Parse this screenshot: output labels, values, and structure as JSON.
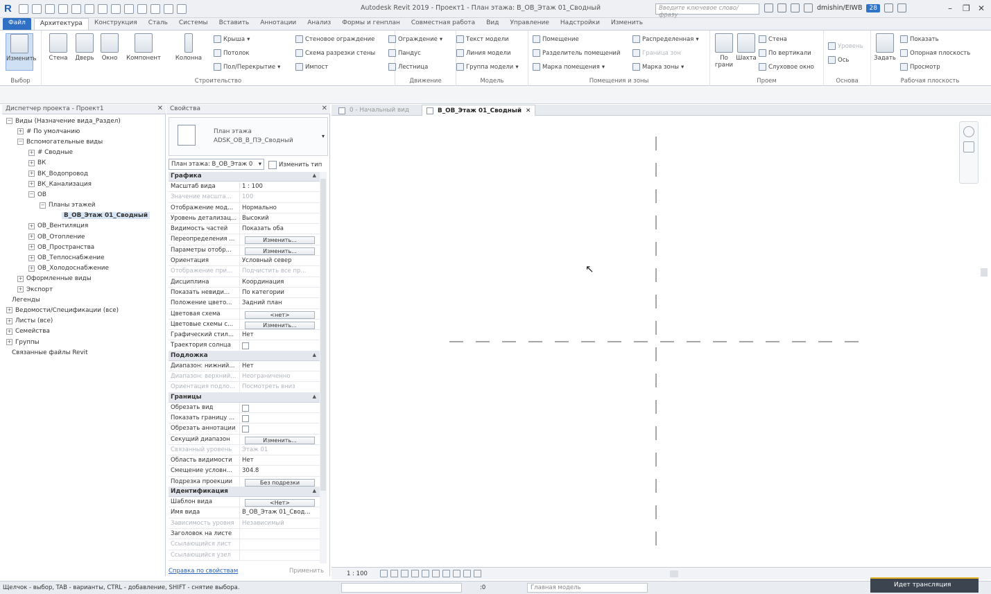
{
  "app": {
    "window_title": "Autodesk Revit 2019 - Проект1 - План этажа: В_ОВ_Этаж 01_Сводный",
    "search_placeholder": "Введите ключевое слово/фразу",
    "user": "dmishin/EIWB",
    "badge": "28",
    "logo": "R"
  },
  "ribbon_tabs": [
    "Файл",
    "Архитектура",
    "Конструкция",
    "Сталь",
    "Системы",
    "Вставить",
    "Аннотации",
    "Анализ",
    "Формы и генплан",
    "Совместная работа",
    "Вид",
    "Управление",
    "Надстройки",
    "Изменить"
  ],
  "ribbon": {
    "groups": [
      "Выбор",
      "Строительство",
      "Движение",
      "Модель",
      "Помещения и зоны",
      "Проем",
      "Основа",
      "Рабочая плоскость"
    ],
    "big_buttons": [
      "Изменить",
      "Стена",
      "Дверь",
      "Окно",
      "Компонент",
      "Колонна",
      "По грани",
      "Шахта",
      "Задать"
    ],
    "small_buttons": [
      "Крыша",
      "Потолок",
      "Пол/Перекрытие",
      "Стеновое ограждение",
      "Схема разрезки стены",
      "Импост",
      "Ограждение",
      "Пандус",
      "Лестница",
      "Текст модели",
      "Линия модели",
      "Группа модели",
      "Помещение",
      "Разделитель помещений",
      "Марка помещения",
      "Распределенная",
      "Граница зон",
      "Марка зоны",
      "Стена",
      "По вертикали",
      "Слуховое окно",
      "Уровень",
      "Ось",
      "Показать",
      "Опорная плоскость",
      "Просмотр"
    ]
  },
  "project_browser": {
    "title": "Диспетчер проекта - Проект1",
    "items": [
      {
        "label": "Виды (Назначение вида_Раздел)",
        "toggle": "⊟"
      },
      {
        "label": "# По умолчанию",
        "toggle": "⊞"
      },
      {
        "label": "Вспомогательные виды",
        "toggle": "⊟"
      },
      {
        "label": "# Сводные",
        "toggle": "⊞"
      },
      {
        "label": "ВК",
        "toggle": "⊞"
      },
      {
        "label": "ВК_Водопровод",
        "toggle": "⊞"
      },
      {
        "label": "ВК_Канализация",
        "toggle": "⊞"
      },
      {
        "label": "ОВ",
        "toggle": "⊟"
      },
      {
        "label": "Планы этажей",
        "toggle": "⊟"
      },
      {
        "label": "В_ОВ_Этаж 01_Сводный",
        "toggle": ""
      },
      {
        "label": "ОВ_Вентиляция",
        "toggle": "⊞"
      },
      {
        "label": "ОВ_Отопление",
        "toggle": "⊞"
      },
      {
        "label": "ОВ_Пространства",
        "toggle": "⊞"
      },
      {
        "label": "ОВ_Теплоснабжение",
        "toggle": "⊞"
      },
      {
        "label": "ОВ_Холодоснабжение",
        "toggle": "⊞"
      },
      {
        "label": "Оформленные виды",
        "toggle": "⊞"
      },
      {
        "label": "Экспорт",
        "toggle": "⊞"
      },
      {
        "label": "Легенды",
        "toggle": ""
      },
      {
        "label": "Ведомости/Спецификации (все)",
        "toggle": "⊞"
      },
      {
        "label": "Листы (все)",
        "toggle": "⊞"
      },
      {
        "label": "Семейства",
        "toggle": "⊞"
      },
      {
        "label": "Группы",
        "toggle": "⊞"
      },
      {
        "label": "Связанные файлы Revit",
        "toggle": ""
      }
    ]
  },
  "properties": {
    "title": "Свойства",
    "type_line1": "План этажа",
    "type_line2": "ADSK_ОВ_В_ПЭ_Сводный",
    "instance_selector": "План этажа: В_ОВ_Этаж 0",
    "edit_type": "Изменить тип",
    "sections": [
      {
        "name": "Графика",
        "rows": [
          [
            "Масштаб вида",
            "1 : 100",
            "",
            false
          ],
          [
            "Значение масшта...",
            "100",
            "",
            true
          ],
          [
            "Отображение мод...",
            "Нормально",
            "",
            false
          ],
          [
            "Уровень детализац...",
            "Высокий",
            "",
            false
          ],
          [
            "Видимость частей",
            "Показать оба",
            "",
            false
          ],
          [
            "Переопределения ...",
            "Изменить...",
            "btn",
            false
          ],
          [
            "Параметры отобр...",
            "Изменить...",
            "btn",
            false
          ],
          [
            "Ориентация",
            "Условный север",
            "",
            false
          ],
          [
            "Отображение при...",
            "Подчистить все пр...",
            "",
            true
          ],
          [
            "Дисциплина",
            "Координация",
            "",
            false
          ],
          [
            "Показать невиди...",
            "По категории",
            "",
            false
          ],
          [
            "Положение цвето...",
            "Задний план",
            "",
            false
          ],
          [
            "Цветовая схема",
            "<нет>",
            "btn",
            false
          ],
          [
            "Цветовые схемы с...",
            "Изменить...",
            "btn",
            false
          ],
          [
            "Графический стил...",
            "Нет",
            "",
            false
          ],
          [
            "Траектория солнца",
            "",
            "chk",
            false
          ]
        ]
      },
      {
        "name": "Подложка",
        "rows": [
          [
            "Диапазон: нижний...",
            "Нет",
            "",
            false
          ],
          [
            "Диапазон: верхний...",
            "Неограниченно",
            "",
            true
          ],
          [
            "Ориентация подло...",
            "Посмотреть вниз",
            "",
            true
          ]
        ]
      },
      {
        "name": "Границы",
        "rows": [
          [
            "Обрезать вид",
            "",
            "chk",
            false
          ],
          [
            "Показать границу ...",
            "",
            "chk",
            false
          ],
          [
            "Обрезать аннотации",
            "",
            "chk",
            false
          ],
          [
            "Секущий диапазон",
            "Изменить...",
            "btn",
            false
          ],
          [
            "Связанный уровень",
            "Этаж 01",
            "",
            true
          ],
          [
            "Область видимости",
            "Нет",
            "",
            false
          ],
          [
            "Смещение условн...",
            "304.8",
            "",
            false
          ],
          [
            "Подрезка проекции",
            "Без подрезки",
            "btn",
            false
          ]
        ]
      },
      {
        "name": "Идентификация",
        "rows": [
          [
            "Шаблон вида",
            "<Нет>",
            "btn",
            false
          ],
          [
            "Имя вида",
            "В_ОВ_Этаж 01_Свод...",
            "",
            false
          ],
          [
            "Зависимость уровня",
            "Независимый",
            "",
            true
          ],
          [
            "Заголовок на листе",
            "",
            "",
            false
          ],
          [
            "Ссылающийся лист",
            "",
            "",
            true
          ],
          [
            "Ссылающийся узел",
            "",
            "",
            true
          ]
        ]
      }
    ],
    "help_link": "Справка по свойствам",
    "apply": "Применить"
  },
  "view_tabs": [
    {
      "label": "0 - Начальный вид",
      "active": false
    },
    {
      "label": "В_ОВ_Этаж 01_Сводный",
      "active": true
    }
  ],
  "view_control": {
    "scale": "1 : 100"
  },
  "status": {
    "hint": "Щелчок - выбор, TAB - варианты, CTRL - добавление, SHIFT - снятие выбора.",
    "zero": ":0",
    "model": "Главная модель",
    "translation": "Идет трансляция"
  }
}
